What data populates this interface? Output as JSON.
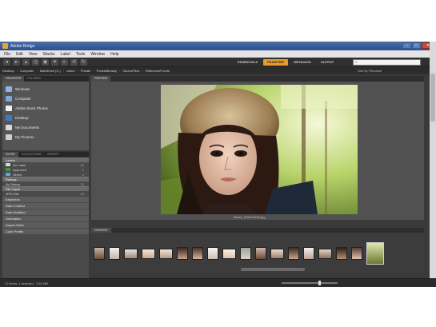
{
  "window": {
    "title": "Adobe Bridge"
  },
  "menu": [
    "File",
    "Edit",
    "View",
    "Stacks",
    "Label",
    "Tools",
    "Window",
    "Help"
  ],
  "workspaces": [
    {
      "label": "ESSENTIALS",
      "active": false
    },
    {
      "label": "FILMSTRIP",
      "active": true
    },
    {
      "label": "METADATA",
      "active": false
    },
    {
      "label": "OUTPUT",
      "active": false
    }
  ],
  "search": {
    "placeholder": ""
  },
  "path": {
    "crumbs": [
      "Desktop",
      "Computer",
      "MainDrive (C:)",
      "Users",
      "Private",
      "PortraitBeauty",
      "SourceFiles",
      "ReferenceProofs"
    ],
    "sort_label": "Sort by Filename"
  },
  "left": {
    "tabs": [
      "FAVORITES",
      "FOLDERS"
    ],
    "favorites": [
      {
        "label": "Windows",
        "color": "#8fb3e6"
      },
      {
        "label": "Computer",
        "color": "#7ea7d9"
      },
      {
        "label": "Adobe Stock Photos",
        "color": "#f0f0f0"
      },
      {
        "label": "Desktop",
        "color": "#3e78c8"
      },
      {
        "label": "My Documents",
        "color": "#d9d9d9"
      },
      {
        "label": "My Pictures",
        "color": "#cfcfcf"
      }
    ],
    "filter_tabs": [
      "FILTER",
      "COLLECTIONS",
      "EXPORT"
    ],
    "labels_head": "Labels",
    "label_rows": [
      {
        "label": "No Label",
        "color": "#d8d8d8",
        "count": "20"
      },
      {
        "label": "Approved",
        "color": "#3f9a3f",
        "count": "1"
      },
      {
        "label": "Select",
        "color": "#5fa8d0",
        "count": "1"
      }
    ],
    "rating_head": "Ratings",
    "rating_row": {
      "label": "No Rating",
      "count": "22"
    },
    "filetype_head": "File Types",
    "filetype_row": {
      "label": "JPEG file",
      "count": "22"
    },
    "collapsed_sections": [
      "Keywords",
      "Date Created",
      "Date Modified",
      "Orientation",
      "Aspect Ratio",
      "Color Profile"
    ]
  },
  "preview": {
    "tab_label": "PREVIEW",
    "caption": "iStock_000013415.jpg"
  },
  "content": {
    "tab_label": "CONTENT",
    "thumbnail_count": 22
  },
  "status": {
    "text": "22 items, 1 selected - 3.61 MB"
  },
  "colors": {
    "accent": "#e59c2c",
    "panel": "#3a3a3a"
  }
}
